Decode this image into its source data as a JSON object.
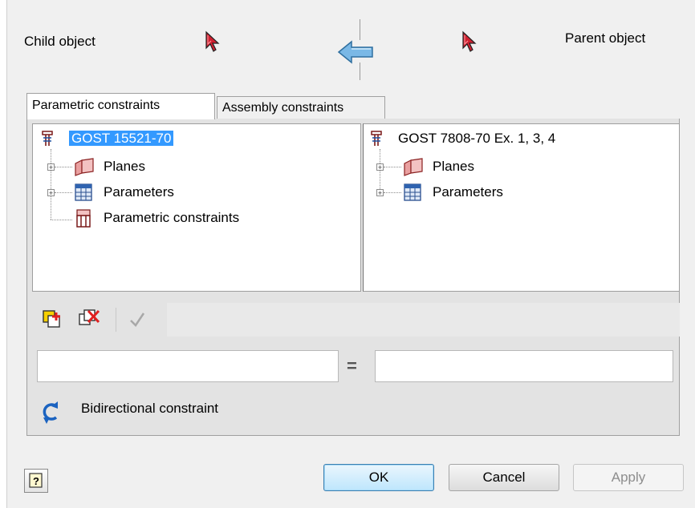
{
  "header": {
    "child_label": "Child object",
    "parent_label": "Parent object"
  },
  "tabs": [
    {
      "label": "Parametric constraints",
      "active": true
    },
    {
      "label": "Assembly constraints",
      "active": false
    }
  ],
  "left_tree": {
    "root": "GOST 15521-70",
    "items": [
      "Planes",
      "Parameters",
      "Parametric constraints"
    ]
  },
  "right_tree": {
    "root": "GOST 7808-70 Ex. 1, 3, 4",
    "items": [
      "Planes",
      "Parameters"
    ]
  },
  "equation": {
    "left_value": "",
    "operator": "=",
    "right_value": ""
  },
  "bidirectional_label": "Bidirectional constraint",
  "buttons": {
    "ok": "OK",
    "cancel": "Cancel",
    "apply": "Apply"
  },
  "colors": {
    "selection": "#3399ff",
    "arrow": "#5fa8d9",
    "cursor": "#d02030",
    "add_icon": "#f2c200",
    "delete_icon": "#e02020"
  }
}
